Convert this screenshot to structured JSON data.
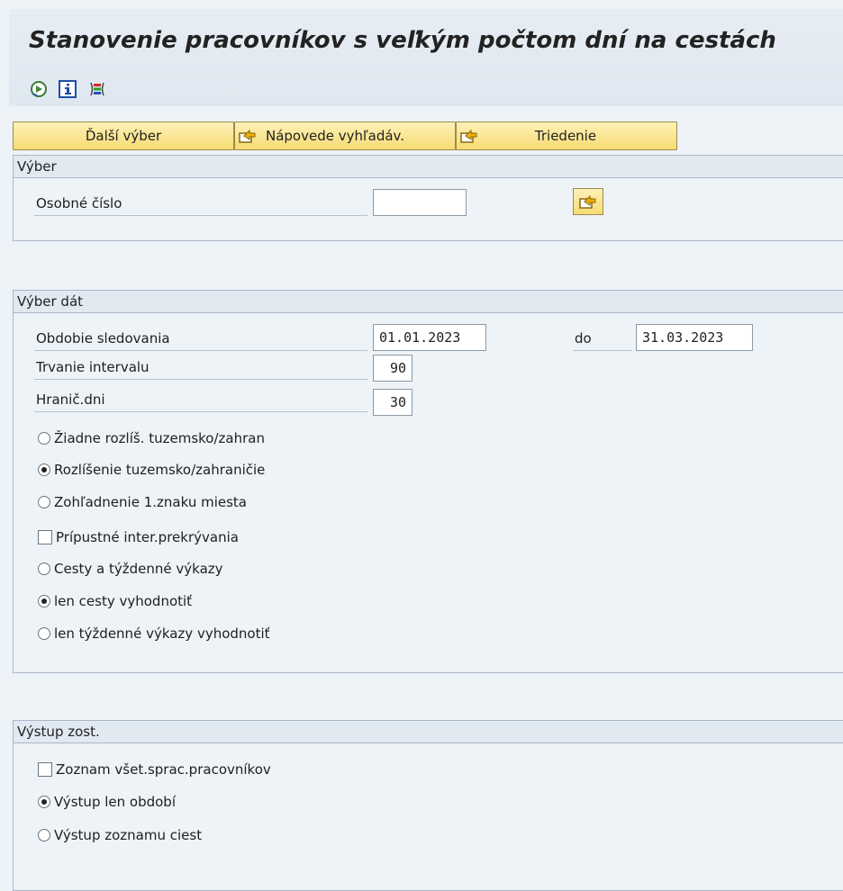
{
  "title": "Stanovenie pracovníkov s veľkým počtom dní na cestách",
  "toolbar": {
    "icons": [
      "execute-icon",
      "info-icon",
      "selection-options-icon"
    ]
  },
  "buttons": {
    "dalsi_vyber": "Ďalší výber",
    "napovede": "Nápovede vyhľadáv.",
    "triedenie": "Triedenie"
  },
  "vyber": {
    "header": "Výber",
    "osobne_cislo_label": "Osobné číslo",
    "osobne_cislo_value": ""
  },
  "vyber_dat": {
    "header": "Výber dát",
    "obdobie_label": "Obdobie sledovania",
    "obdobie_from": "01.01.2023",
    "do_label": "do",
    "obdobie_to": "31.03.2023",
    "trvanie_label": "Trvanie intervalu",
    "trvanie_value": "90",
    "hranic_label": "Hranič.dni",
    "hranic_value": "30",
    "options": [
      {
        "label": "Žiadne rozlíš. tuzemsko/zahran",
        "type": "radio",
        "checked": false
      },
      {
        "label": "Rozlíšenie tuzemsko/zahraničie",
        "type": "radio",
        "checked": true
      },
      {
        "label": "Zohľadnenie 1.znaku miesta",
        "type": "radio",
        "checked": false
      },
      {
        "label": "Prípustné inter.prekrývania",
        "type": "checkbox",
        "checked": false
      },
      {
        "label": "Cesty a týždenné výkazy",
        "type": "radio",
        "checked": false
      },
      {
        "label": "len cesty vyhodnotiť",
        "type": "radio",
        "checked": true
      },
      {
        "label": "len týždenné výkazy vyhodnotiť",
        "type": "radio",
        "checked": false
      }
    ]
  },
  "vystup": {
    "header": "Výstup zost.",
    "options": [
      {
        "label": "Zoznam všet.sprac.pracovníkov",
        "type": "checkbox",
        "checked": false
      },
      {
        "label": "Výstup len období",
        "type": "radio",
        "checked": true
      },
      {
        "label": "Výstup zoznamu ciest",
        "type": "radio",
        "checked": false
      }
    ]
  },
  "colors": {
    "button_top": "#fdf1b7",
    "button_bottom": "#f7dc74",
    "background": "#eef3f8",
    "group_header": "#e1e9f1"
  }
}
